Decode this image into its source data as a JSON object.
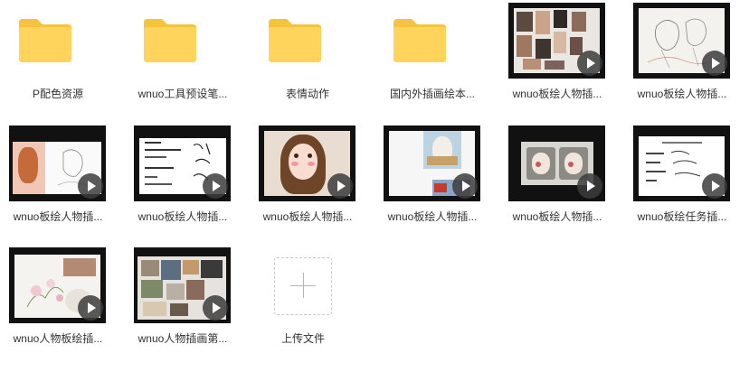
{
  "colors": {
    "folder": "#FFD45C",
    "folder_tab": "#F7C33F",
    "label": "#333333",
    "play_bg": "#3c3c3c"
  },
  "items": [
    {
      "kind": "folder",
      "icon": "folder-icon",
      "label": "P配色资源"
    },
    {
      "kind": "folder",
      "icon": "folder-icon",
      "label": "wnuo工具预设笔..."
    },
    {
      "kind": "folder",
      "icon": "folder-icon",
      "label": "表情动作"
    },
    {
      "kind": "folder",
      "icon": "folder-icon",
      "label": "国内外插画绘本..."
    },
    {
      "kind": "video",
      "icon": "play-icon",
      "label": "wnuo板绘人物插..."
    },
    {
      "kind": "video",
      "icon": "play-icon",
      "label": "wnuo板绘人物插..."
    },
    {
      "kind": "video",
      "icon": "play-icon",
      "label": "wnuo板绘人物插..."
    },
    {
      "kind": "video",
      "icon": "play-icon",
      "label": "wnuo板绘人物插..."
    },
    {
      "kind": "video",
      "icon": "play-icon",
      "label": "wnuo板绘人物插..."
    },
    {
      "kind": "video",
      "icon": "play-icon",
      "label": "wnuo板绘人物插..."
    },
    {
      "kind": "video",
      "icon": "play-icon",
      "label": "wnuo板绘人物插..."
    },
    {
      "kind": "video",
      "icon": "play-icon",
      "label": "wnuo板绘任务插..."
    },
    {
      "kind": "video",
      "icon": "play-icon",
      "label": "wnuo人物板绘插..."
    },
    {
      "kind": "video",
      "icon": "play-icon",
      "label": "wnuo人物插画第..."
    },
    {
      "kind": "upload",
      "icon": "plus-icon",
      "label": "上传文件"
    }
  ]
}
